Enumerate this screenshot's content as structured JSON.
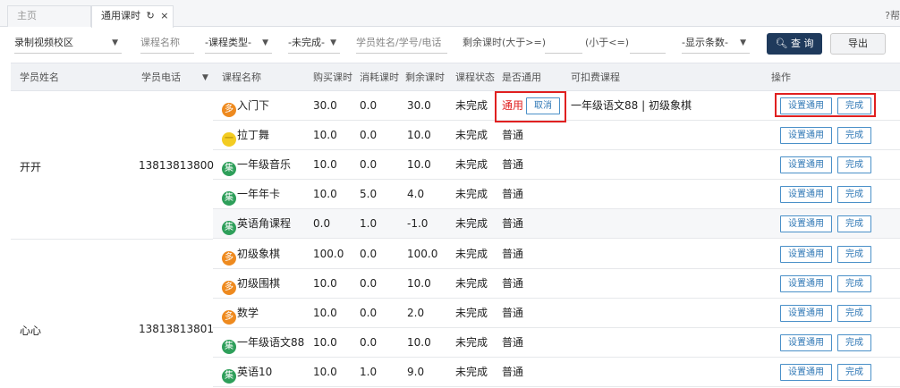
{
  "tabs": [
    {
      "label": "主页"
    },
    {
      "label": "通用课时",
      "refresh_icon": "↻",
      "close_icon": "×"
    }
  ],
  "help_label": "?帮",
  "filters": {
    "campus": "录制视频校区",
    "course_name": "课程名称",
    "course_type": "-课程类型-",
    "status": "-未完成-",
    "student": "学员姓名/学号/电话",
    "remain_gt": "剩余课时(大于>=)",
    "remain_lt": "(小于<=)",
    "display_count": "-显示条数-",
    "query_button": "查 询",
    "export_button": "导出"
  },
  "columns": {
    "student_name": "学员姓名",
    "phone": "学员电话",
    "course_name": "课程名称",
    "bought": "购买课时",
    "consumed": "消耗课时",
    "remaining": "剩余课时",
    "status": "课程状态",
    "is_general": "是否通用",
    "deductible": "可扣费课程",
    "ops": "操作"
  },
  "actions": {
    "set_general": "设置通用",
    "complete": "完成",
    "cancel": "取消"
  },
  "groups": [
    {
      "name": "开开",
      "phone": "13813813800"
    },
    {
      "name": "心心",
      "phone": "13813813801"
    }
  ],
  "rows": [
    {
      "badge": "多",
      "color": "orange",
      "course": "入门下",
      "bought": "30.0",
      "consumed": "0.0",
      "remaining": "30.0",
      "status": "未完成",
      "general": "通用",
      "deductible": "一年级语文88 | 初级象棋"
    },
    {
      "badge": "一",
      "color": "yellow",
      "course": "拉丁舞",
      "bought": "10.0",
      "consumed": "0.0",
      "remaining": "10.0",
      "status": "未完成",
      "general": "普通",
      "deductible": ""
    },
    {
      "badge": "集",
      "color": "green",
      "course": "一年级音乐",
      "bought": "10.0",
      "consumed": "0.0",
      "remaining": "10.0",
      "status": "未完成",
      "general": "普通",
      "deductible": ""
    },
    {
      "badge": "集",
      "color": "green",
      "course": "一年年卡",
      "bought": "10.0",
      "consumed": "5.0",
      "remaining": "4.0",
      "status": "未完成",
      "general": "普通",
      "deductible": ""
    },
    {
      "badge": "集",
      "color": "green",
      "course": "英语角课程",
      "bought": "0.0",
      "consumed": "1.0",
      "remaining": "-1.0",
      "status": "未完成",
      "general": "普通",
      "deductible": ""
    },
    {
      "badge": "多",
      "color": "orange",
      "course": "初级象棋",
      "bought": "100.0",
      "consumed": "0.0",
      "remaining": "100.0",
      "status": "未完成",
      "general": "普通",
      "deductible": ""
    },
    {
      "badge": "多",
      "color": "orange",
      "course": "初级围棋",
      "bought": "10.0",
      "consumed": "0.0",
      "remaining": "10.0",
      "status": "未完成",
      "general": "普通",
      "deductible": ""
    },
    {
      "badge": "多",
      "color": "orange",
      "course": "数学",
      "bought": "10.0",
      "consumed": "0.0",
      "remaining": "2.0",
      "status": "未完成",
      "general": "普通",
      "deductible": ""
    },
    {
      "badge": "集",
      "color": "green",
      "course": "一年级语文88",
      "bought": "10.0",
      "consumed": "0.0",
      "remaining": "10.0",
      "status": "未完成",
      "general": "普通",
      "deductible": ""
    },
    {
      "badge": "集",
      "color": "green",
      "course": "英语10",
      "bought": "10.0",
      "consumed": "1.0",
      "remaining": "9.0",
      "status": "未完成",
      "general": "普通",
      "deductible": ""
    }
  ],
  "colors": {
    "accent": "#1f3a5c",
    "highlight": "#e02020",
    "link": "#2f77b5"
  }
}
